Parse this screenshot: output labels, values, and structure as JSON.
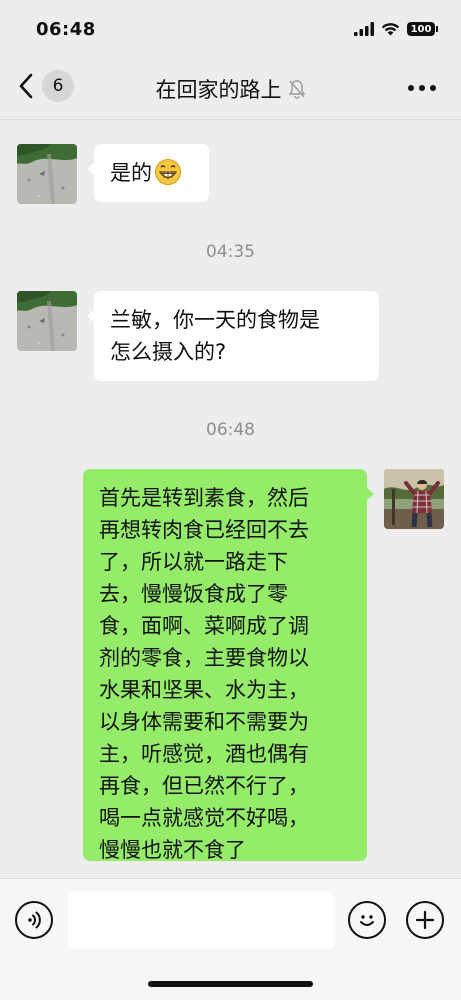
{
  "status_bar": {
    "time": "06:48",
    "battery": "100"
  },
  "nav": {
    "unread_count": "6",
    "title": "在回家的路上",
    "mute_icon": "bell-slash-icon",
    "more_icon": "more-dots-icon",
    "back_icon": "chevron-left-icon"
  },
  "messages": [
    {
      "type": "incoming",
      "text": "是的",
      "emoji": "grinning-face-icon"
    },
    {
      "type": "timestamp",
      "text": "04:35"
    },
    {
      "type": "incoming",
      "lines": [
        "兰敏，你一天的食物是",
        "怎么摄入的?"
      ]
    },
    {
      "type": "timestamp",
      "text": "06:48"
    },
    {
      "type": "outgoing",
      "lines": [
        "首先是转到素食，然后",
        "再想转肉食已经回不去",
        "了，所以就一路走下",
        "去，慢慢饭食成了零",
        "食，面啊、菜啊成了调",
        "剂的零食，主要食物以",
        "水果和坚果、水为主，",
        "以身体需要和不需要为",
        "主，听感觉，酒也偶有",
        "再食，但已然不行了，",
        "喝一点就感觉不好喝，",
        "慢慢也就不食了"
      ]
    }
  ],
  "input_bar": {
    "voice_icon": "voice-icon",
    "emoji_icon": "emoji-smile-icon",
    "add_icon": "plus-circle-icon",
    "input_value": ""
  },
  "colors": {
    "outgoing_bubble": "#95ec69",
    "incoming_bubble": "#ffffff",
    "background": "#ededed"
  }
}
